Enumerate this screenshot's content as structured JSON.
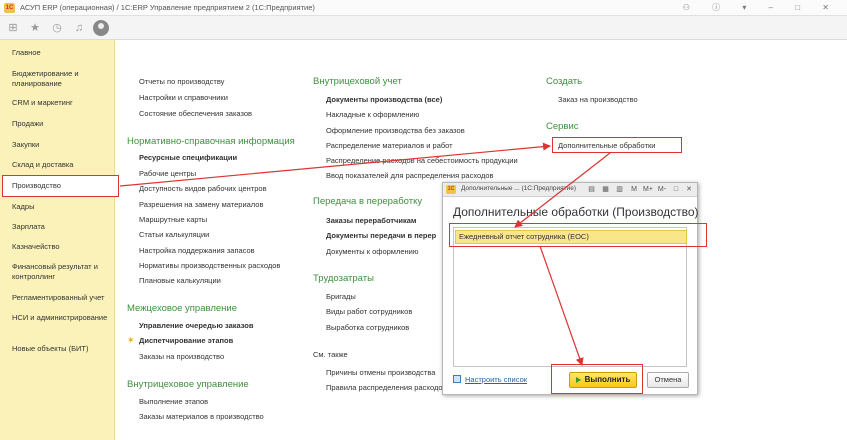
{
  "titlebar": {
    "logo": "1С",
    "title": "АСУП ERP (операционная) / 1С:ERP Управление предприятием 2  (1С:Предприятие)",
    "controls": "⚇ ⓘ ▾ – □ ✕"
  },
  "toolbar": {
    "icons": [
      "grid-icon",
      "star-icon",
      "history-icon",
      "bell-icon",
      "user-icon"
    ]
  },
  "sidebar": {
    "items": [
      {
        "label": "Главное"
      },
      {
        "label": "Бюджетирование и планирование"
      },
      {
        "label": "CRM и маркетинг"
      },
      {
        "label": "Продажи"
      },
      {
        "label": "Закупки"
      },
      {
        "label": "Склад и доставка"
      },
      {
        "label": "Производство"
      },
      {
        "label": "Кадры"
      },
      {
        "label": "Зарплата"
      },
      {
        "label": "Казначейство"
      },
      {
        "label": "Финансовый результат и контроллинг"
      },
      {
        "label": "Регламентированный учет"
      },
      {
        "label": "НСИ и администрирование"
      },
      {
        "label": "Новые объекты (БИТ)"
      }
    ],
    "active_index": 6
  },
  "col1": {
    "top_links": [
      "Отчеты по производству",
      "Настройки и справочники",
      "Состояние обеспечения заказов"
    ],
    "nsi_title": "Нормативно-справочная информация",
    "nsi_links": [
      "Ресурсные спецификации",
      "Рабочие центры",
      "Доступность видов рабочих центров",
      "Разрешения на замену материалов",
      "Маршрутные карты",
      "Статьи калькуляции",
      "Настройка поддержания запасов",
      "Нормативы производственных расходов",
      "Плановые калькуляции"
    ],
    "mezh_title": "Межцеховое управление",
    "mezh_links": [
      "Управление очередью заказов",
      "Диспетчирование этапов",
      "Заказы на производство"
    ],
    "vnutr_title": "Внутрицеховое управление",
    "vnutr_links": [
      "Выполнение этапов",
      "Заказы материалов в производство"
    ]
  },
  "col2": {
    "uchet_title": "Внутрицеховой учет",
    "uchet_links": [
      "Документы производства (все)",
      "Накладные к оформлению",
      "Оформление производства без заказов",
      "Распределение материалов и работ",
      "Распределение расходов на себестоимость продукции",
      "Ввод показателей для распределения расходов"
    ],
    "pererab_title": "Передача в переработку",
    "pererab_links": [
      "Заказы переработчикам",
      "Документы передачи в перер",
      "Документы к оформлению"
    ],
    "trud_title": "Трудозатраты",
    "trud_links": [
      "Бригады",
      "Виды работ сотрудников",
      "Выработка сотрудников"
    ],
    "see_also": "См. также",
    "see_also_links": [
      "Причины отмены производства",
      "Правила распределения расходо"
    ]
  },
  "col3": {
    "create_title": "Создать",
    "create_links": [
      "Заказ на производство"
    ],
    "service_title": "Сервис",
    "service_links": [
      "Дополнительные обработки"
    ]
  },
  "dialog": {
    "logo": "1С",
    "title": "Дополнительные ... (1С:Предприятие)",
    "toolbar_buttons": [
      "M",
      "M+",
      "M-",
      "□",
      "✕"
    ],
    "heading": "Дополнительные обработки (Производство)",
    "items": [
      "Ежедневный отчет сотрудника (ЕОС)"
    ],
    "setup_link": "Настроить список",
    "run_button": "Выполнить",
    "cancel_button": "Отмена"
  },
  "colors": {
    "sidebar_bg": "#faf2b8",
    "section_green": "#3f8e3f",
    "annotation_red": "#d33",
    "run_button": "#f6c91a"
  }
}
